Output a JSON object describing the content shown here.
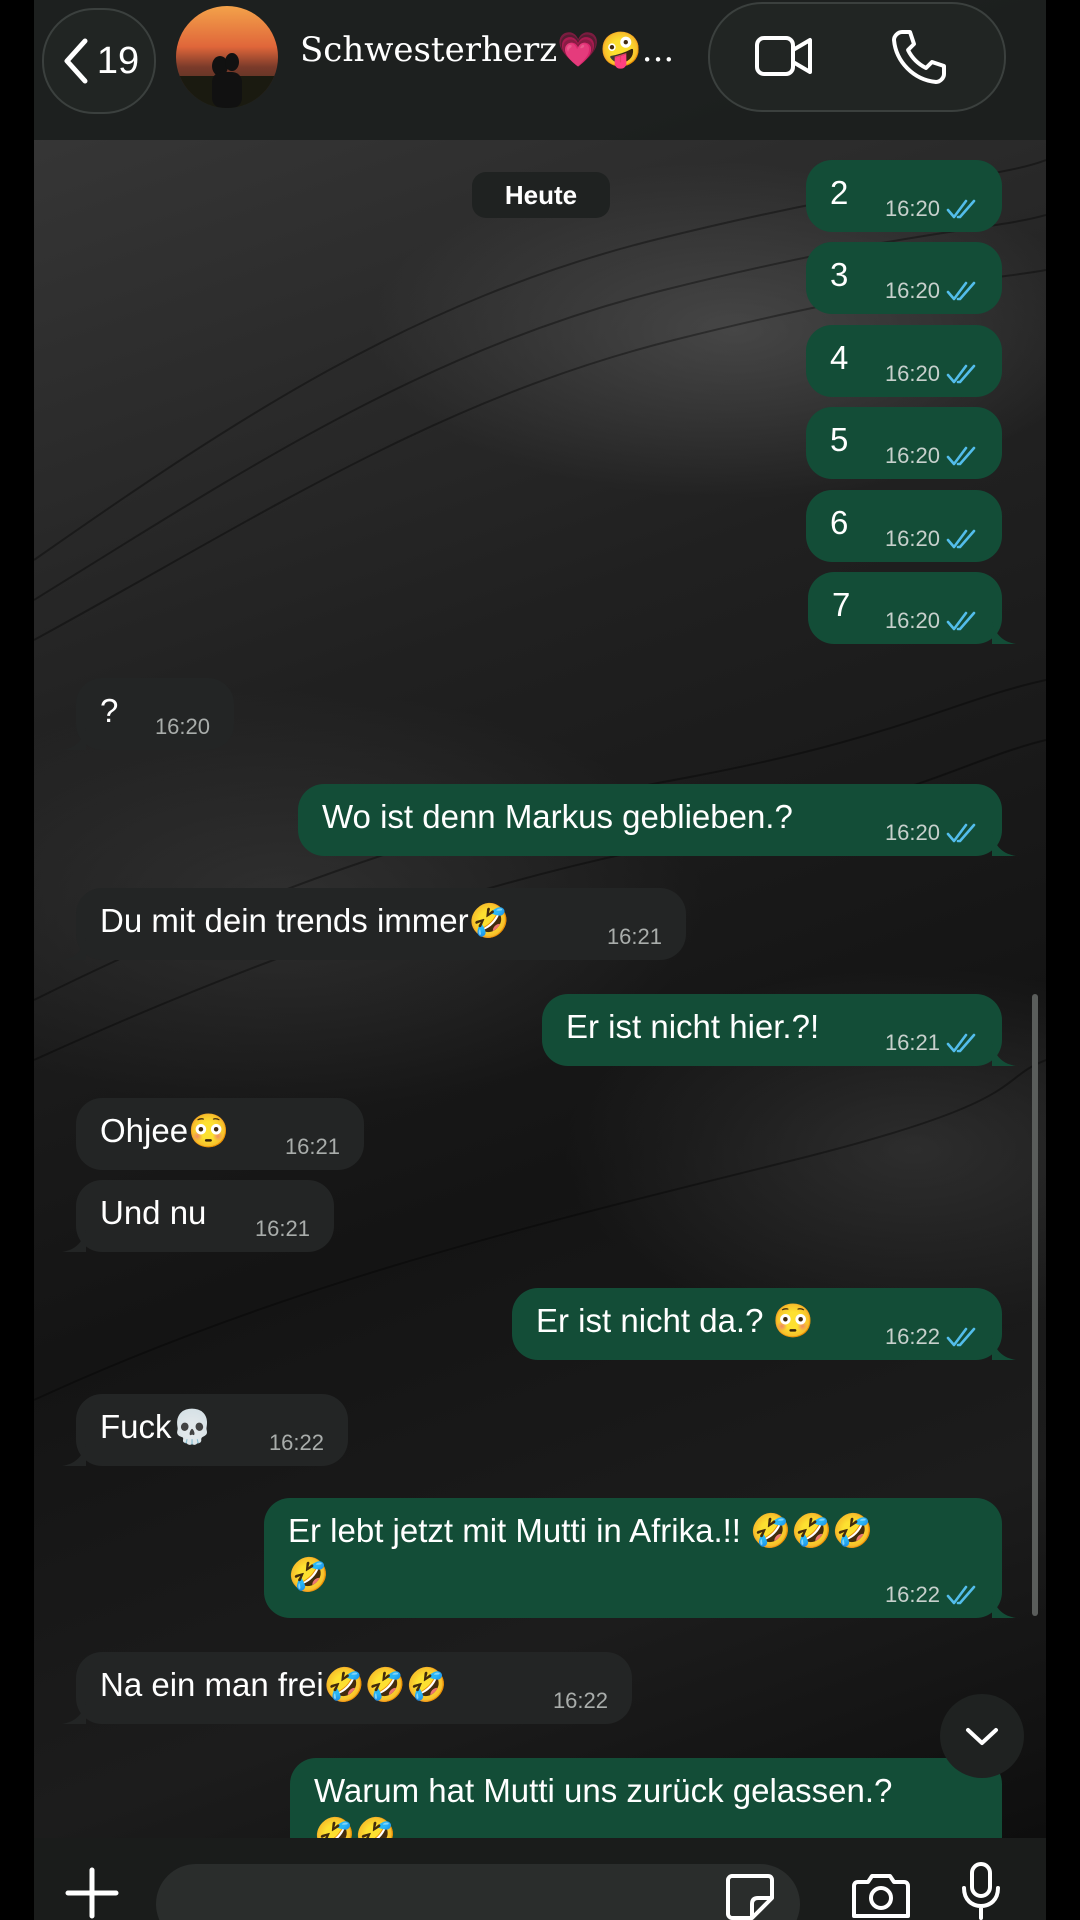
{
  "header": {
    "back_count": "19",
    "contact_name": "Schwesterherz💗🤪..."
  },
  "date_chip": "Heute",
  "messages": [
    {
      "dir": "out",
      "text": "2",
      "time": "16:20"
    },
    {
      "dir": "out",
      "text": "3",
      "time": "16:20"
    },
    {
      "dir": "out",
      "text": "4",
      "time": "16:20"
    },
    {
      "dir": "out",
      "text": "5",
      "time": "16:20"
    },
    {
      "dir": "out",
      "text": "6",
      "time": "16:20"
    },
    {
      "dir": "out",
      "text": "7",
      "time": "16:20"
    },
    {
      "dir": "in",
      "text": "?",
      "time": "16:20"
    },
    {
      "dir": "out",
      "text": "Wo ist denn Markus geblieben.?",
      "time": "16:20"
    },
    {
      "dir": "in",
      "text": "Du mit dein trends immer🤣",
      "time": "16:21"
    },
    {
      "dir": "out",
      "text": "Er ist nicht hier.?!",
      "time": "16:21"
    },
    {
      "dir": "in",
      "text": "Ohjee😳",
      "time": "16:21"
    },
    {
      "dir": "in",
      "text": "Und nu",
      "time": "16:21"
    },
    {
      "dir": "out",
      "text": "Er ist nicht da.? 😳",
      "time": "16:22"
    },
    {
      "dir": "in",
      "text": "Fuck💀",
      "time": "16:22"
    },
    {
      "dir": "out",
      "text": "Er lebt jetzt mit Mutti in Afrika.!! 🤣🤣🤣",
      "text2": "🤣",
      "time": "16:22"
    },
    {
      "dir": "in",
      "text": "Na ein man frei🤣🤣🤣",
      "time": "16:22"
    },
    {
      "dir": "out",
      "text": "Warum hat Mutti uns zurück gelassen.?",
      "text2": "🤣🤣"
    }
  ],
  "icons": [
    "chevron-left-icon",
    "video-call-icon",
    "phone-icon",
    "chevron-down-icon",
    "plus-icon",
    "sticker-icon",
    "camera-icon",
    "microphone-icon",
    "double-check-icon"
  ],
  "colors": {
    "outgoing_bubble": "#134d37",
    "incoming_bubble": "#232525",
    "read_tick": "#53bdeb",
    "header_bg": "#1c1f1e"
  }
}
